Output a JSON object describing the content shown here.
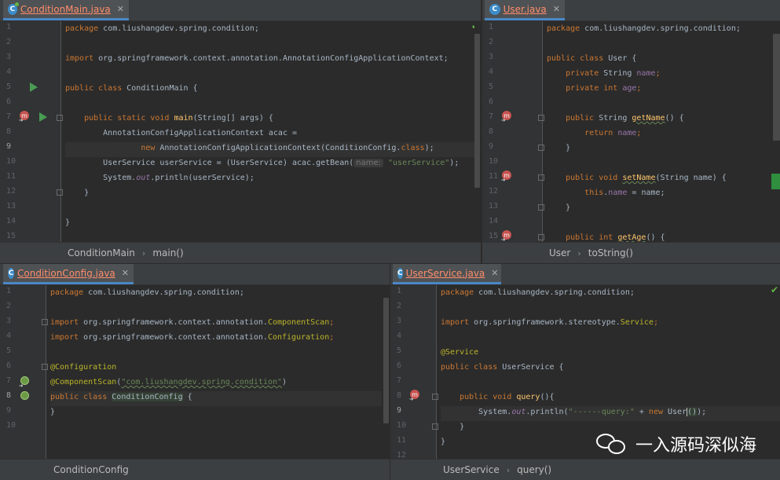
{
  "panes": {
    "main": {
      "tab": "ConditionMain.java",
      "breadcrumb": [
        "ConditionMain",
        "main()"
      ]
    },
    "user": {
      "tab": "User.java",
      "breadcrumb": [
        "User",
        "toString()"
      ]
    },
    "config": {
      "tab": "ConditionConfig.java",
      "breadcrumb": [
        "ConditionConfig"
      ]
    },
    "service": {
      "tab": "UserService.java",
      "breadcrumb": [
        "UserService",
        "query()"
      ]
    }
  },
  "code": {
    "main": {
      "l1a": "package",
      "l1b": " com.liushangdev.spring.condition;",
      "l3a": "import",
      "l3b": " org.springframework.context.annotation.AnnotationConfigApplicationContext;",
      "l5a": "public class",
      "l5b": " ConditionMain {",
      "l7a": "    public static void ",
      "l7b": "main",
      "l7c": "(String[] args) {",
      "l8": "        AnnotationConfigApplicationContext acac =",
      "l9a": "                ",
      "l9b": "new",
      "l9c": " AnnotationConfigApplicationContext(ConditionConfig.",
      "l9d": "class",
      "l9e": ");",
      "l10a": "        UserService userService = (UserService) acac.getBean(",
      "l10hint": "name:",
      "l10b": " \"userService\"",
      "l10c": ");",
      "l11a": "        System.",
      "l11b": "out",
      "l11c": ".println(userService);",
      "l12": "    }",
      "l14": "}"
    },
    "user": {
      "l1a": "package",
      "l1b": " com.liushangdev.spring.condition;",
      "l3a": "public class",
      "l3b": " User {",
      "l4a": "    private",
      "l4b": " String ",
      "l4c": "name",
      "l4d": ";",
      "l5a": "    private int ",
      "l5b": "age",
      "l5c": ";",
      "l7a": "    public",
      "l7b": " String ",
      "l7c": "getName",
      "l7d": "() {",
      "l8a": "        return ",
      "l8b": "name",
      "l8c": ";",
      "l9": "    }",
      "l11a": "    public void ",
      "l11b": "setName",
      "l11c": "(String name) {",
      "l12a": "        ",
      "l12b": "this",
      "l12c": ".",
      "l12d": "name",
      "l12e": " = name;",
      "l13": "    }",
      "l15a": "    public int ",
      "l15b": "getAge",
      "l15c": "() {"
    },
    "config": {
      "l1a": "package",
      "l1b": " com.liushangdev.spring.condition;",
      "l3a": "import",
      "l3b": " org.springframework.context.annotation.",
      "l3c": "ComponentScan",
      "l3d": ";",
      "l4a": "import",
      "l4b": " org.springframework.context.annotation.",
      "l4c": "Configuration",
      "l4d": ";",
      "l6": "@Configuration",
      "l7a": "@ComponentScan",
      "l7b": "(",
      "l7c": "\"com.liushangdev.spring.condition\"",
      "l7d": ")",
      "l8a": "public class",
      "l8b": " ",
      "l8c": "ConditionConfig",
      "l8d": " {",
      "l9": "}"
    },
    "service": {
      "l1a": "package",
      "l1b": " com.liushangdev.spring.condition;",
      "l3a": "import",
      "l3b": " org.springframework.stereotype.",
      "l3c": "Service",
      "l3d": ";",
      "l5": "@Service",
      "l6a": "public class",
      "l6b": " UserService {",
      "l8a": "    public void ",
      "l8b": "query",
      "l8c": "(){",
      "l9a": "        System.",
      "l9b": "out",
      "l9c": ".println(",
      "l9d": "\"------query:\"",
      "l9e": " + ",
      "l9f": "new",
      "l9g": " User",
      "l9h": "()",
      "l9i": ");",
      "l10": "    }",
      "l11": "}"
    }
  },
  "watermark": "一入源码深似海"
}
